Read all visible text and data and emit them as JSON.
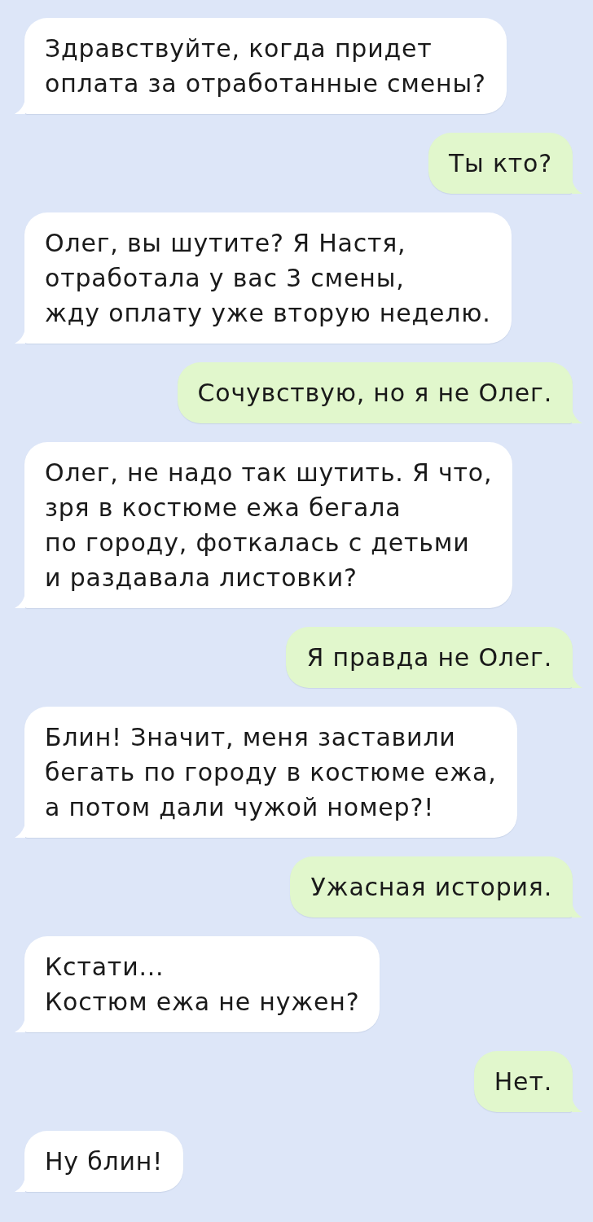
{
  "messages": [
    {
      "kind": "incoming",
      "text": "Здравствуйте, когда придет\nоплата за отработанные смены?"
    },
    {
      "kind": "outgoing",
      "text": "Ты кто?"
    },
    {
      "kind": "incoming",
      "text": "Олег, вы шутите? Я Настя,\nотработала у вас 3 смены,\nжду оплату уже вторую неделю."
    },
    {
      "kind": "outgoing",
      "text": "Сочувствую, но я не Олег."
    },
    {
      "kind": "incoming",
      "text": "Олег, не надо так шутить. Я что,\nзря в костюме ежа бегала\nпо городу, фоткалась с детьми\nи раздавала листовки?"
    },
    {
      "kind": "outgoing",
      "text": "Я правда не Олег."
    },
    {
      "kind": "incoming",
      "text": "Блин! Значит, меня заставили\nбегать по городу в костюме ежа,\nа потом дали чужой номер?!"
    },
    {
      "kind": "outgoing",
      "text": "Ужасная история."
    },
    {
      "kind": "incoming",
      "text": "Кстати...\nКостюм ежа не нужен?"
    },
    {
      "kind": "outgoing",
      "text": "Нет."
    },
    {
      "kind": "incoming",
      "text": "Ну блин!"
    }
  ]
}
